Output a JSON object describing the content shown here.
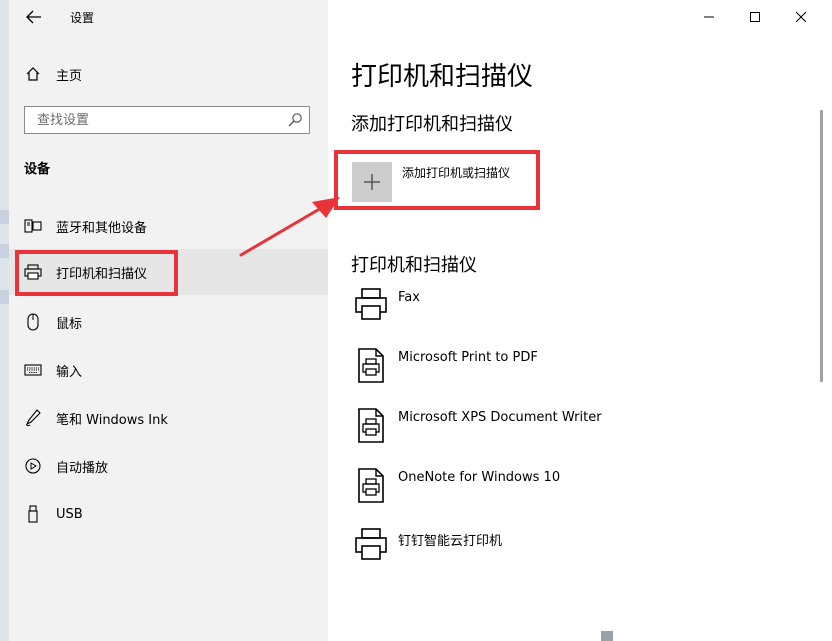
{
  "window": {
    "app_title": "设置",
    "back_icon": "arrow-left-icon",
    "minimize_icon": "minimize-icon",
    "maximize_icon": "maximize-icon",
    "close_icon": "close-icon"
  },
  "sidebar": {
    "home_label": "主页",
    "search_placeholder": "查找设置",
    "section_label": "设备",
    "items": [
      {
        "label": "蓝牙和其他设备",
        "icon": "bluetooth-devices-icon",
        "selected": false
      },
      {
        "label": "打印机和扫描仪",
        "icon": "printer-icon",
        "selected": true
      },
      {
        "label": "鼠标",
        "icon": "mouse-icon",
        "selected": false
      },
      {
        "label": "输入",
        "icon": "keyboard-icon",
        "selected": false
      },
      {
        "label": "笔和 Windows Ink",
        "icon": "pen-icon",
        "selected": false
      },
      {
        "label": "自动播放",
        "icon": "autoplay-icon",
        "selected": false
      },
      {
        "label": "USB",
        "icon": "usb-icon",
        "selected": false
      }
    ]
  },
  "main": {
    "title": "打印机和扫描仪",
    "add_section_heading": "添加打印机和扫描仪",
    "add_button_label": "添加打印机或扫描仪",
    "list_heading": "打印机和扫描仪",
    "printers": [
      {
        "name": "Fax",
        "icon": "printer-icon"
      },
      {
        "name": "Microsoft Print to PDF",
        "icon": "document-printer-icon"
      },
      {
        "name": "Microsoft XPS Document Writer",
        "icon": "document-printer-icon"
      },
      {
        "name": "OneNote for Windows 10",
        "icon": "document-printer-icon"
      },
      {
        "name": "钉钉智能云打印机",
        "icon": "printer-icon"
      }
    ]
  },
  "annotations": {
    "highlight_color": "#e8333b"
  }
}
